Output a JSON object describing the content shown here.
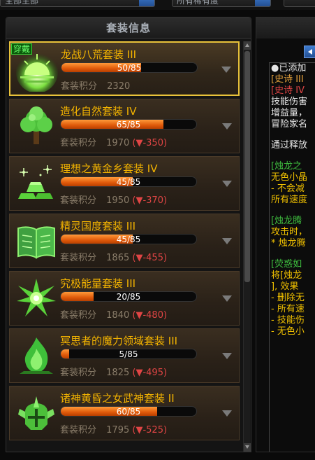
{
  "top_filters": [
    {
      "label": "全部主部"
    },
    {
      "label": "所有稀有度"
    }
  ],
  "panel": {
    "title": "套装信息"
  },
  "score_label": "套装积分",
  "wearing_tag": "穿戴",
  "sets": [
    {
      "name": "龙战八荒套装 III",
      "progress_text": "50/85",
      "progress": 0.59,
      "score": "2320",
      "delta": "",
      "icon": "sunrise-icon",
      "selected": true
    },
    {
      "name": "造化自然套装 IV",
      "progress_text": "65/85",
      "progress": 0.76,
      "score": "1970",
      "delta": "(▼-350)",
      "icon": "tree-icon",
      "selected": false
    },
    {
      "name": "理想之黄金乡套装 IV",
      "progress_text": "45/85",
      "progress": 0.53,
      "score": "1950",
      "delta": "(▼-370)",
      "icon": "gold-bars-icon",
      "selected": false
    },
    {
      "name": "精灵国度套装 III",
      "progress_text": "45/85",
      "progress": 0.53,
      "score": "1865",
      "delta": "(▼-455)",
      "icon": "book-icon",
      "selected": false
    },
    {
      "name": "究极能量套装 III",
      "progress_text": "20/85",
      "progress": 0.24,
      "score": "1840",
      "delta": "(▼-480)",
      "icon": "energy-burst-icon",
      "selected": false
    },
    {
      "name": "冥思者的魔力领域套装 III",
      "progress_text": "5/85",
      "progress": 0.06,
      "score": "1825",
      "delta": "(▼-495)",
      "icon": "flame-icon",
      "selected": false
    },
    {
      "name": "诸神黄昏之女武神套装 II",
      "progress_text": "60/85",
      "progress": 0.71,
      "score": "1795",
      "delta": "(▼-525)",
      "icon": "valkyrie-helmet-icon",
      "selected": false
    }
  ],
  "detail_lines": [
    {
      "text": "●已添加",
      "color": "#e6e6e6"
    },
    {
      "text": "[史诗 III",
      "color": "#e6a23c"
    },
    {
      "text": "[史诗 IV",
      "color": "#e04545"
    },
    {
      "text": "技能伤害",
      "color": "#e6e6e6"
    },
    {
      "text": "增益量，",
      "color": "#e6e6e6"
    },
    {
      "text": "冒险家名",
      "color": "#e6e6e6"
    },
    {
      "text": "",
      "color": ""
    },
    {
      "text": "通过释放",
      "color": "#e6e6e6"
    },
    {
      "text": "",
      "color": ""
    },
    {
      "text": "[烛龙之",
      "color": "#3fbf3f"
    },
    {
      "text": "无色小晶",
      "color": "#f0c000"
    },
    {
      "text": "- 不会减",
      "color": "#f0c000"
    },
    {
      "text": "所有速度",
      "color": "#f0c000"
    },
    {
      "text": "",
      "color": ""
    },
    {
      "text": "[烛龙腾",
      "color": "#3fbf3f"
    },
    {
      "text": "攻击时，",
      "color": "#f0c000"
    },
    {
      "text": "* 烛龙腾",
      "color": "#f0c000"
    },
    {
      "text": "",
      "color": ""
    },
    {
      "text": "[荧惑如",
      "color": "#3fbf3f"
    },
    {
      "text": "将[烛龙",
      "color": "#f0c000"
    },
    {
      "text": "], 效果",
      "color": "#f0c000"
    },
    {
      "text": "- 删除无",
      "color": "#f0c000"
    },
    {
      "text": "- 所有速",
      "color": "#f0c000"
    },
    {
      "text": "- 技能伤",
      "color": "#f0c000"
    },
    {
      "text": "- 无色小",
      "color": "#f0c000"
    }
  ]
}
